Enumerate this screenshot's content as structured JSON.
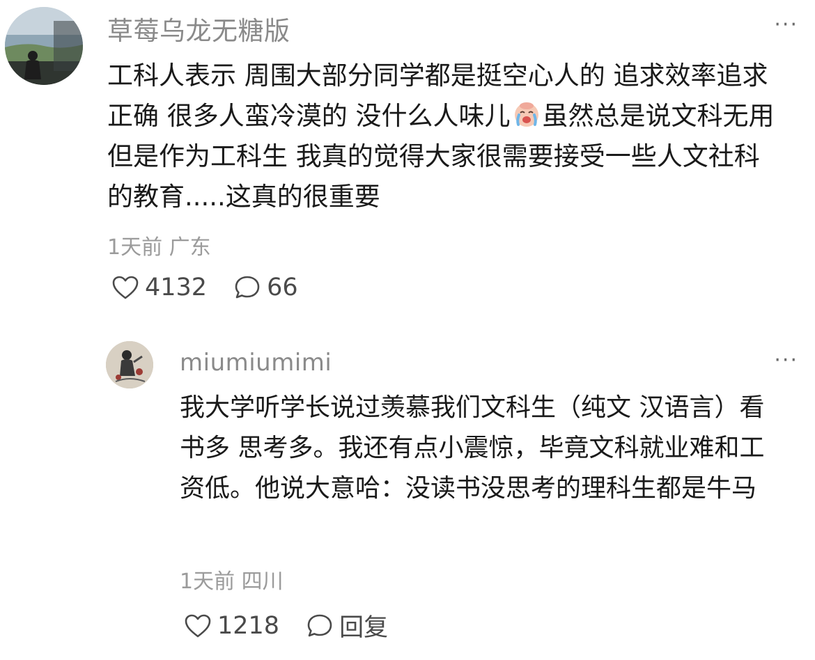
{
  "comments": [
    {
      "username": "草莓乌龙无糖版",
      "more": "···",
      "text_part1": "工科人表示 周围大部分同学都是挺空心人的 追求效率追求正确 很多人蛮冷漠的 没什么人味儿",
      "emoji": "crying-face",
      "text_part2": "虽然总是说文科无用 但是作为工科生 我真的觉得大家很需要接受一些人文社科的教育.....这真的很重要",
      "meta": "1天前 广东",
      "likes": "4132",
      "replies": "66"
    },
    {
      "username": "miumiumimi",
      "more": "···",
      "text": "我大学听学长说过羡慕我们文科生（纯文 汉语言）看书多 思考多。我还有点小震惊，毕竟文科就业难和工资低。他说大意哈：没读书没思考的理科生都是牛马",
      "meta": "1天前 四川",
      "likes": "1218",
      "reply_label": "回复"
    }
  ],
  "colors": {
    "username": "#8a8a8a",
    "meta": "#9b9b9b",
    "body": "#1a1a1a",
    "icons": "#4a4a4a"
  }
}
